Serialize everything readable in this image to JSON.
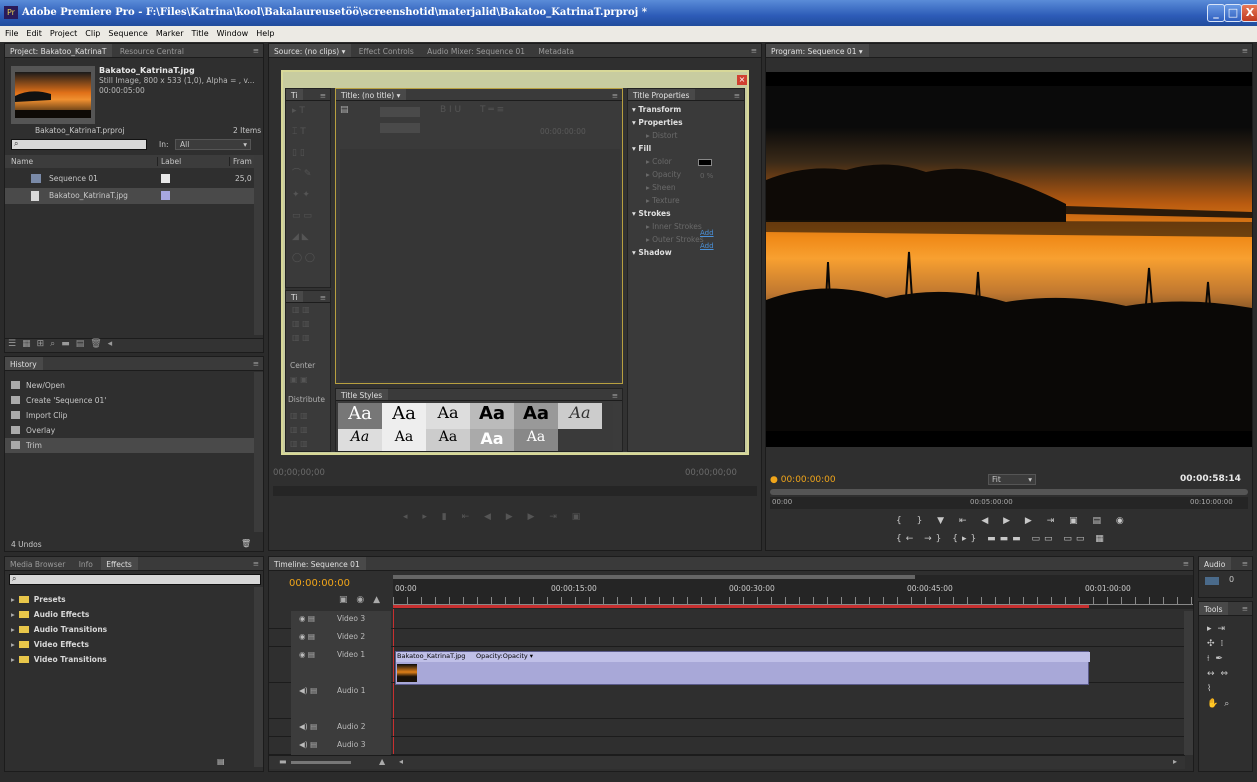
{
  "window": {
    "app_icon": "Pr",
    "title": "Adobe Premiere Pro - F:\\Files\\Katrina\\kool\\Bakalaureusetöö\\screenshotid\\materjalid\\Bakatoo_KatrinaT.prproj *",
    "min": "_",
    "max": "□",
    "close": "X"
  },
  "menu": [
    "File",
    "Edit",
    "Project",
    "Clip",
    "Sequence",
    "Marker",
    "Title",
    "Window",
    "Help"
  ],
  "project": {
    "tabs": [
      "Project: Bakatoo_KatrinaT",
      "Resource Central"
    ],
    "clip_name": "Bakatoo_KatrinaT.jpg",
    "clip_info": "Still Image, 800 x 533 (1,0), Alpha = , v...",
    "clip_duration": "00:00:05:00",
    "project_file": "Bakatoo_KatrinaT.prproj",
    "item_count": "2 Items",
    "in_label": "In:",
    "in_value": "All",
    "columns": [
      "Name",
      "Label",
      "Fram"
    ],
    "items": [
      {
        "name": "Sequence 01",
        "label_color": "#e8e8e8",
        "rate": "25,0"
      },
      {
        "name": "Bakatoo_KatrinaT.jpg",
        "label_color": "#a8a8e0",
        "rate": ""
      }
    ]
  },
  "history": {
    "tab": "History",
    "items": [
      "New/Open",
      "Create 'Sequence 01'",
      "Import Clip",
      "Overlay",
      "Trim"
    ],
    "undos": "4 Undos"
  },
  "effects": {
    "tabs": [
      "Media Browser",
      "Info",
      "Effects"
    ],
    "folders": [
      "Presets",
      "Audio Effects",
      "Audio Transitions",
      "Video Effects",
      "Video Transitions"
    ]
  },
  "source": {
    "tabs": [
      "Source: (no clips)",
      "Effect Controls",
      "Audio Mixer: Sequence 01",
      "Metadata"
    ],
    "timecode_left": "00;00;00;00",
    "timecode_right": "00;00;00;00"
  },
  "titler": {
    "tools_tab": "Ti",
    "actions_tab": "Ti",
    "title_tab": "Title: (no title)",
    "timecode": "00:00:00:00",
    "center_label": "Center",
    "distribute_label": "Distribute",
    "styles_tab": "Title Styles",
    "style_samples": [
      "Aa",
      "Aa",
      "Aa",
      "Aa",
      "Aa",
      "Aa",
      "Aa",
      "Aa",
      "Aa",
      "Aa",
      "Aa"
    ],
    "properties_tab": "Title Properties",
    "properties": [
      {
        "label": "Transform",
        "bold": true,
        "indent": 0
      },
      {
        "label": "Properties",
        "bold": true,
        "indent": 0
      },
      {
        "label": "Distort",
        "bold": false,
        "indent": 1
      },
      {
        "label": "Fill",
        "bold": true,
        "indent": 0
      },
      {
        "label": "Color",
        "bold": false,
        "indent": 1
      },
      {
        "label": "Opacity",
        "bold": false,
        "indent": 1
      },
      {
        "label": "Sheen",
        "bold": false,
        "indent": 1
      },
      {
        "label": "Texture",
        "bold": false,
        "indent": 1
      },
      {
        "label": "Strokes",
        "bold": true,
        "indent": 0
      },
      {
        "label": "Inner Strokes",
        "bold": false,
        "indent": 1
      },
      {
        "label": "Outer Strokes",
        "bold": false,
        "indent": 1
      },
      {
        "label": "Shadow",
        "bold": true,
        "indent": 0
      }
    ],
    "opacity_value": "0 %",
    "add_label": "Add"
  },
  "program": {
    "tab": "Program: Sequence 01",
    "timecode_current": "00:00:00:00",
    "fit_label": "Fit",
    "timecode_total": "00:00:58:14",
    "ruler": [
      "00:00",
      "00:05:00:00",
      "00:10:00:00"
    ]
  },
  "timeline": {
    "tab": "Timeline: Sequence 01",
    "timecode": "00:00:00:00",
    "ruler": [
      "00:00",
      "00:00:15:00",
      "00:00:30:00",
      "00:00:45:00",
      "00:01:00:00"
    ],
    "tracks": [
      "Video 3",
      "Video 2",
      "Video 1",
      "Audio 1",
      "Audio 2",
      "Audio 3"
    ],
    "clip_label": "Bakatoo_KatrinaT.jpg",
    "clip_effect": "Opacity:Opacity"
  },
  "audio_panel": {
    "tab": "Audio",
    "value": "0"
  },
  "tools_panel": {
    "tab": "Tools"
  },
  "colors": {
    "accent": "#f0a51a",
    "clip": "#a8a8d8",
    "playhead": "#c83030",
    "titler_border": "#d8c890"
  }
}
